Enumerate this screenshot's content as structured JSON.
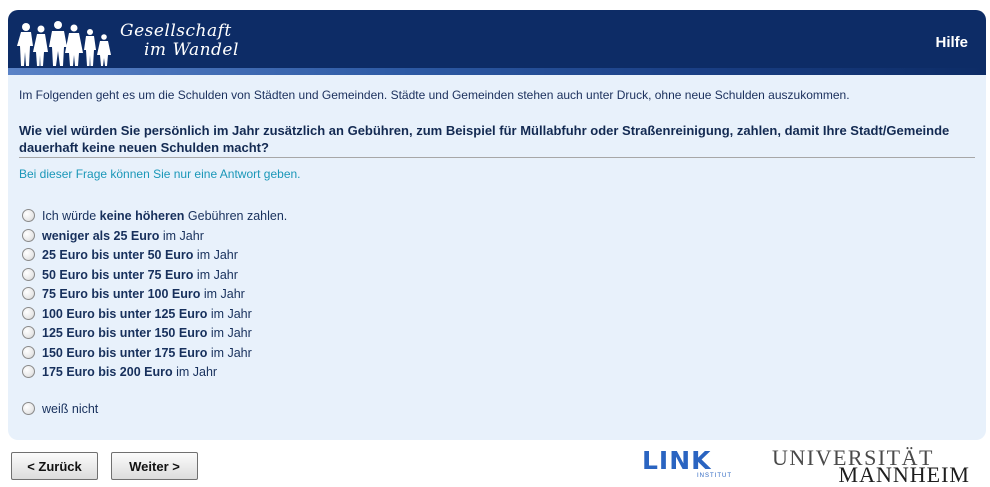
{
  "header": {
    "logo_line1": "Gesellschaft",
    "logo_line2": "im Wandel",
    "help_label": "Hilfe"
  },
  "intro": "Im Folgenden geht es um die Schulden von Städten und Gemeinden. Städte und Gemeinden stehen auch unter Druck, ohne neue Schulden auszukommen.",
  "question": "Wie viel würden Sie persönlich im Jahr zusätzlich an Gebühren, zum Beispiel für Müllabfuhr oder Straßenreinigung, zahlen, damit Ihre Stadt/Gemeinde dauerhaft keine neuen Schulden macht?",
  "hint": "Bei dieser Frage können Sie nur eine Antwort geben.",
  "options": [
    {
      "pre": "Ich würde ",
      "bold": "keine höheren",
      "post": " Gebühren zahlen."
    },
    {
      "pre": "",
      "bold": "weniger als 25 Euro",
      "post": " im Jahr"
    },
    {
      "pre": "",
      "bold": "25 Euro bis unter 50 Euro",
      "post": " im Jahr"
    },
    {
      "pre": "",
      "bold": "50 Euro bis unter 75 Euro",
      "post": " im Jahr"
    },
    {
      "pre": "",
      "bold": "75 Euro bis unter 100 Euro",
      "post": " im Jahr"
    },
    {
      "pre": "",
      "bold": "100 Euro bis unter 125 Euro",
      "post": " im Jahr"
    },
    {
      "pre": "",
      "bold": "125 Euro bis unter 150 Euro",
      "post": " im Jahr"
    },
    {
      "pre": "",
      "bold": "150 Euro bis unter 175 Euro",
      "post": " im Jahr"
    },
    {
      "pre": "",
      "bold": "175 Euro bis 200 Euro",
      "post": " im Jahr"
    },
    {
      "pre": "weiß nicht",
      "bold": "",
      "post": ""
    }
  ],
  "nav": {
    "back_label": "< Zurück",
    "next_label": "Weiter >"
  },
  "footer": {
    "link_logo": "LINK",
    "link_sub": "INSTITUT",
    "uni_line1": "UNIVERSITÄT",
    "uni_line2": "MANNHEIM"
  },
  "colors": {
    "header_bg": "#0d2c66",
    "panel_bg": "#e8f1fb",
    "hint_text": "#1a97b8",
    "link_blue": "#2a64c1"
  }
}
